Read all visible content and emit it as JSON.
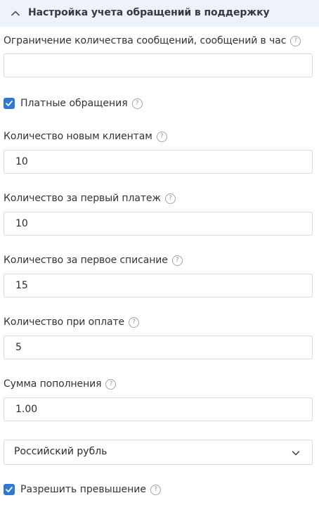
{
  "section": {
    "title": "Настройка учета обращений в поддержку",
    "expanded": true
  },
  "help_glyph": "?",
  "fields": {
    "limit": {
      "label": "Ограничение количества сообщений, сообщений в час",
      "value": ""
    },
    "paid_requests": {
      "label": "Платные обращения",
      "checked": true
    },
    "new_clients": {
      "label": "Количество новым клиентам",
      "value": "10"
    },
    "first_payment": {
      "label": "Количество за первый платеж",
      "value": "10"
    },
    "first_charge": {
      "label": "Количество за первое списание",
      "value": "15"
    },
    "on_payment": {
      "label": "Количество при оплате",
      "value": "5"
    },
    "topup_amount": {
      "label": "Сумма пополнения",
      "value": "1.00"
    },
    "currency": {
      "value": "Российский рубль"
    },
    "allow_overdraft": {
      "label": "Разрешить превышение",
      "checked": true
    }
  },
  "colors": {
    "header_bg": "#edf2fb",
    "checkbox": "#2f78d4",
    "border": "#d7dbe0"
  }
}
